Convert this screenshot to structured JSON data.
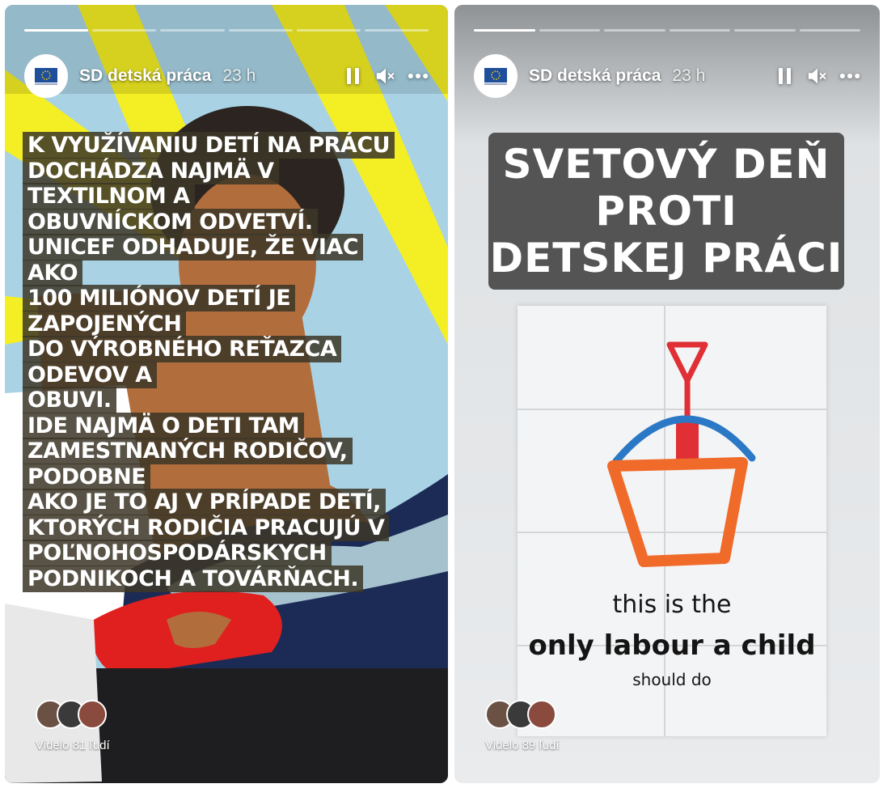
{
  "stories": [
    {
      "progress": [
        1,
        0,
        0,
        0,
        0,
        0
      ],
      "account_name": "SD detská práca",
      "time_ago": "23 h",
      "caption_lines": [
        "K využívaniu detí na prácu",
        "dochádza najmä v textilnom a",
        "obuvníckom odvetví.",
        "Unicef odhaduje, že viac ako",
        "100 miliónov detí je zapojených",
        "do výrobného reťazca odevov a",
        "obuvi.",
        "Ide najmä o deti tam",
        "zamestnaných rodičov, podobne",
        "ako je to aj v prípade detí,",
        "ktorých rodičia pracujú v",
        "poľnohospodárskych",
        "podnikoch a továrňach."
      ],
      "viewers": "Videlo 81 ľudí"
    },
    {
      "progress": [
        1,
        0,
        0,
        0,
        0,
        0
      ],
      "account_name": "SD detská práca",
      "time_ago": "23 h",
      "title_lines": [
        "SVETOVÝ DEŇ PROTI",
        "DETSKEJ PRÁCI"
      ],
      "poster_lines": [
        "this is the",
        "only labour a child",
        "should do"
      ],
      "viewers": "Videlo 89 ľudí"
    }
  ],
  "icons": {
    "pause": "pause-icon",
    "mute": "speaker-muted-icon",
    "more": "more-dots-icon",
    "avatar_logo": "eu-flag-logo"
  },
  "colors": {
    "caption_bg": "#3c3728",
    "title_bg": "#545454",
    "bucket_orange": "#f06a2a",
    "shovel_red": "#e02f35",
    "water_blue": "#2b78c6"
  }
}
